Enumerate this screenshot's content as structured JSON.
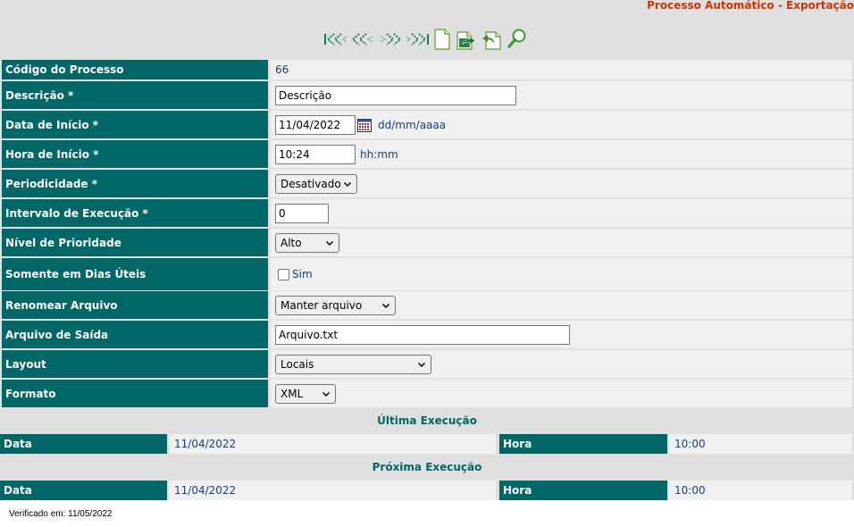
{
  "page_title": "Processo Automático - Exportação",
  "toolbar": {
    "icons": [
      "first-page-icon",
      "previous-page-icon",
      "next-page-icon",
      "last-page-icon",
      "new-document-icon",
      "export-document-icon",
      "undo-document-icon",
      "search-icon"
    ]
  },
  "form": {
    "codigo_label": "Código do Processo",
    "codigo_value": "66",
    "descricao_label": "Descrição *",
    "descricao_value": "Descrição",
    "data_inicio_label": "Data de Início *",
    "data_inicio_value": "11/04/2022",
    "data_format_hint": "dd/mm/aaaa",
    "hora_inicio_label": "Hora de Início *",
    "hora_inicio_value": "10:24",
    "hora_format_hint": "hh:mm",
    "periodicidade_label": "Periodicidade *",
    "periodicidade_selected": "Desativado",
    "intervalo_label": "Intervalo de Execução *",
    "intervalo_value": "0",
    "prioridade_label": "Nível de Prioridade",
    "prioridade_selected": "Alto",
    "dias_uteis_label": "Somente em Dias Úteis",
    "dias_uteis_option": "Sim",
    "dias_uteis_checked": false,
    "renomear_label": "Renomear Arquivo",
    "renomear_selected": "Manter arquivo",
    "arquivo_saida_label": "Arquivo de Saída",
    "arquivo_saida_value": "Arquivo.txt",
    "layout_label": "Layout",
    "layout_selected": "Locais",
    "formato_label": "Formato",
    "formato_selected": "XML"
  },
  "ultima_execucao": {
    "heading": "Última Execução",
    "data_label": "Data",
    "data_value": "11/04/2022",
    "hora_label": "Hora",
    "hora_value": "10:00"
  },
  "proxima_execucao": {
    "heading": "Próxima Execução",
    "data_label": "Data",
    "data_value": "11/04/2022",
    "hora_label": "Hora",
    "hora_value": "10:00"
  },
  "footer": "Verificado em: 11/05/2022",
  "colors": {
    "label_bg": "#016666",
    "value_bg": "#f0f0f0",
    "page_bg": "#e0e0e0",
    "title": "#cc3300",
    "value_text": "#1a3f7a"
  }
}
